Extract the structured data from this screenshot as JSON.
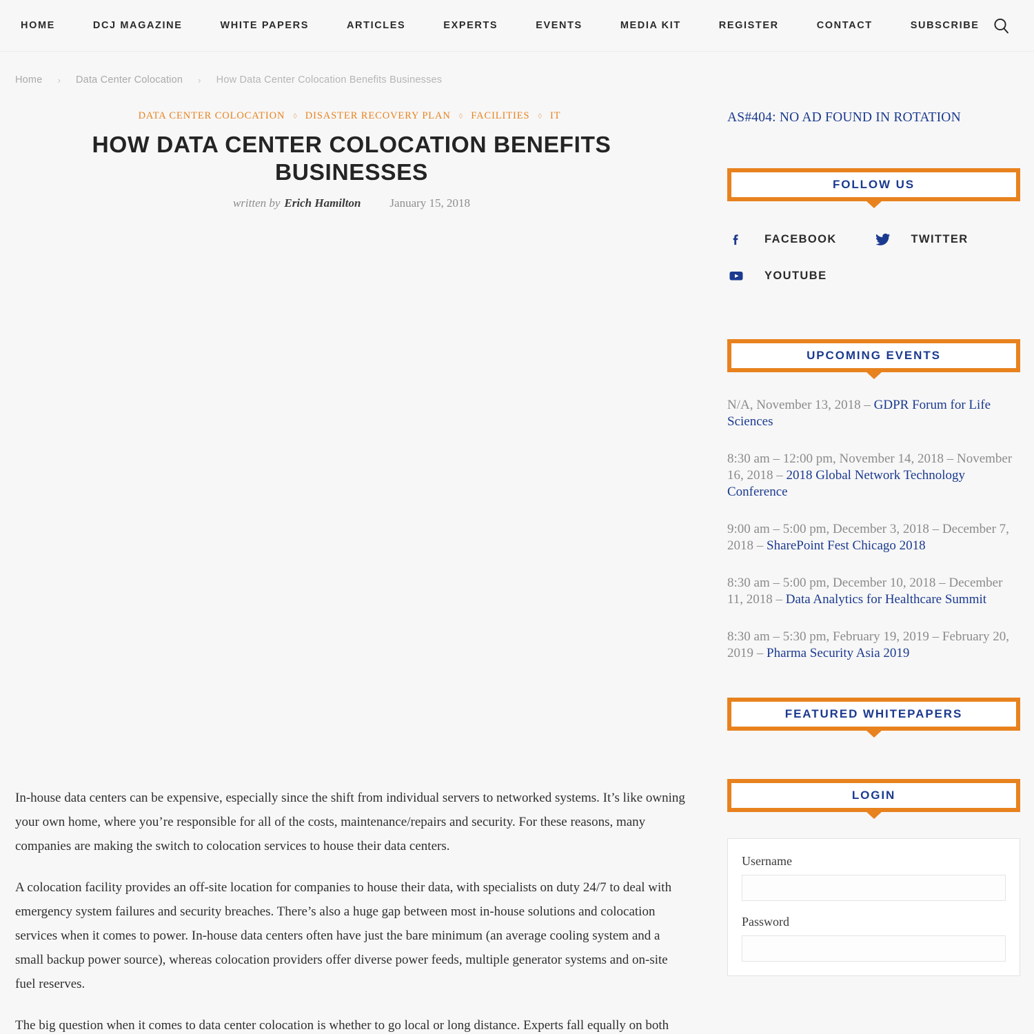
{
  "nav": {
    "items": [
      {
        "label": "HOME"
      },
      {
        "label": "DCJ MAGAZINE"
      },
      {
        "label": "WHITE PAPERS"
      },
      {
        "label": "ARTICLES"
      },
      {
        "label": "EXPERTS"
      },
      {
        "label": "EVENTS"
      },
      {
        "label": "MEDIA KIT"
      },
      {
        "label": "REGISTER"
      },
      {
        "label": "CONTACT"
      },
      {
        "label": "SUBSCRIBE"
      }
    ],
    "search_icon": "search-icon"
  },
  "breadcrumb": {
    "items": [
      {
        "label": "Home"
      },
      {
        "label": "Data Center Colocation"
      },
      {
        "label": "How Data Center Colocation Benefits Businesses"
      }
    ],
    "separator": "›"
  },
  "article": {
    "categories": [
      {
        "label": "DATA CENTER COLOCATION"
      },
      {
        "label": "DISASTER RECOVERY PLAN"
      },
      {
        "label": "FACILITIES"
      },
      {
        "label": "IT"
      }
    ],
    "category_separator": "◊",
    "title": "HOW DATA CENTER COLOCATION BENEFITS BUSINESSES",
    "written_by_label": "written by",
    "author": "Erich Hamilton",
    "date": "January 15, 2018",
    "paragraphs": [
      "In-house data centers can be expensive, especially since the shift from individual servers to networked systems. It’s like owning your own home, where you’re responsible for all of the costs, maintenance/repairs and security. For these reasons, many companies are making the switch to colocation services to house their data centers.",
      "A colocation facility provides an off-site location for companies to house their data, with specialists on duty 24/7 to deal with emergency system failures and security breaches. There’s also a huge gap between most in-house solutions and colocation services when it comes to power. In-house data centers often have just the bare minimum (an average cooling system and a small backup power source), whereas colocation providers offer diverse power feeds, multiple generator systems and on-site fuel reserves.",
      "The big question when it comes to data center colocation is whether to go local or long distance. Experts fall equally on both"
    ]
  },
  "sidebar": {
    "ad_notice": "AS#404: NO AD FOUND IN ROTATION",
    "follow_us": {
      "title": "FOLLOW US",
      "socials": [
        {
          "label": "FACEBOOK",
          "icon": "facebook-icon"
        },
        {
          "label": "TWITTER",
          "icon": "twitter-icon"
        },
        {
          "label": "YOUTUBE",
          "icon": "youtube-icon"
        }
      ]
    },
    "upcoming_events": {
      "title": "UPCOMING EVENTS",
      "events": [
        {
          "when": "N/A, November 13, 2018 – ",
          "title": "GDPR Forum for Life Sciences"
        },
        {
          "when": "8:30 am – 12:00 pm, November 14, 2018 – November 16, 2018 – ",
          "title": "2018 Global Network Technology Conference"
        },
        {
          "when": "9:00 am – 5:00 pm, December 3, 2018 – December 7, 2018 – ",
          "title": "SharePoint Fest Chicago 2018"
        },
        {
          "when": "8:30 am – 5:00 pm, December 10, 2018 – December 11, 2018 – ",
          "title": "Data Analytics for Healthcare Summit"
        },
        {
          "when": "8:30 am – 5:30 pm, February 19, 2019 – February 20, 2019 – ",
          "title": "Pharma Security Asia 2019"
        }
      ]
    },
    "featured_whitepapers": {
      "title": "FEATURED WHITEPAPERS"
    },
    "login": {
      "title": "LOGIN",
      "username_label": "Username",
      "username_value": "",
      "password_label": "Password",
      "password_value": ""
    }
  },
  "colors": {
    "accent_orange": "#e8821e",
    "link_blue": "#1b3a8f",
    "page_bg": "#f7f7f7",
    "text_dark": "#242424",
    "muted_gray": "#8b8b8b"
  }
}
